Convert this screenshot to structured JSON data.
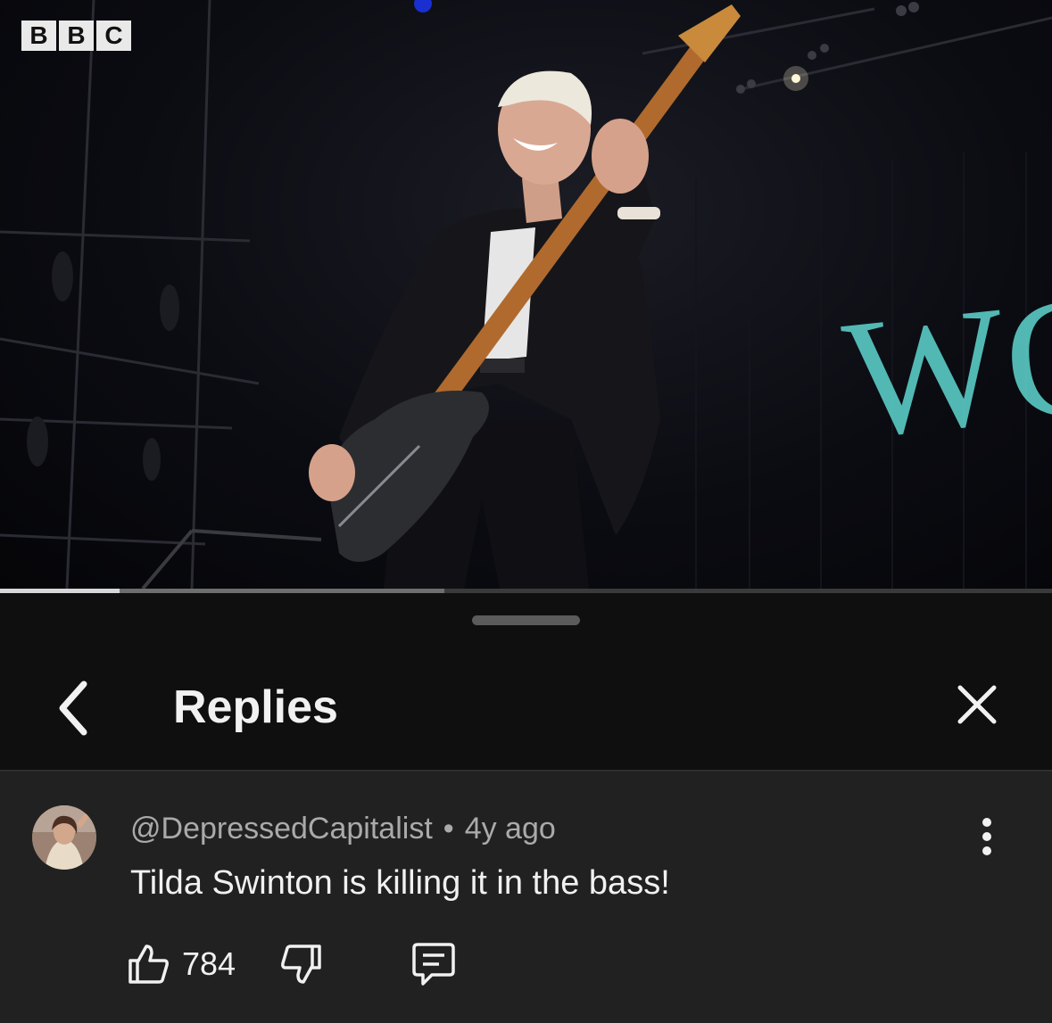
{
  "video": {
    "channel_logo": [
      "B",
      "B",
      "C"
    ],
    "backdrop_text": "WC",
    "progress_played": 0.114,
    "progress_buffered": 0.422
  },
  "sheet": {
    "title": "Replies",
    "back_icon": "chevron-left-icon",
    "close_icon": "close-icon"
  },
  "comment": {
    "author": "@DepressedCapitalist",
    "separator": "•",
    "time": "4y ago",
    "text": "Tilda Swinton is killing it in the bass!",
    "like_count": "784",
    "icons": {
      "like": "thumbs-up-icon",
      "dislike": "thumbs-down-icon",
      "reply": "comment-icon",
      "more": "more-vertical-icon"
    }
  },
  "colors": {
    "background": "#0f0f0f",
    "comment_background": "#212121",
    "primary_text": "#f1f1f1",
    "secondary_text": "#aaaaaa",
    "backdrop_text": "#5fd6d0"
  }
}
